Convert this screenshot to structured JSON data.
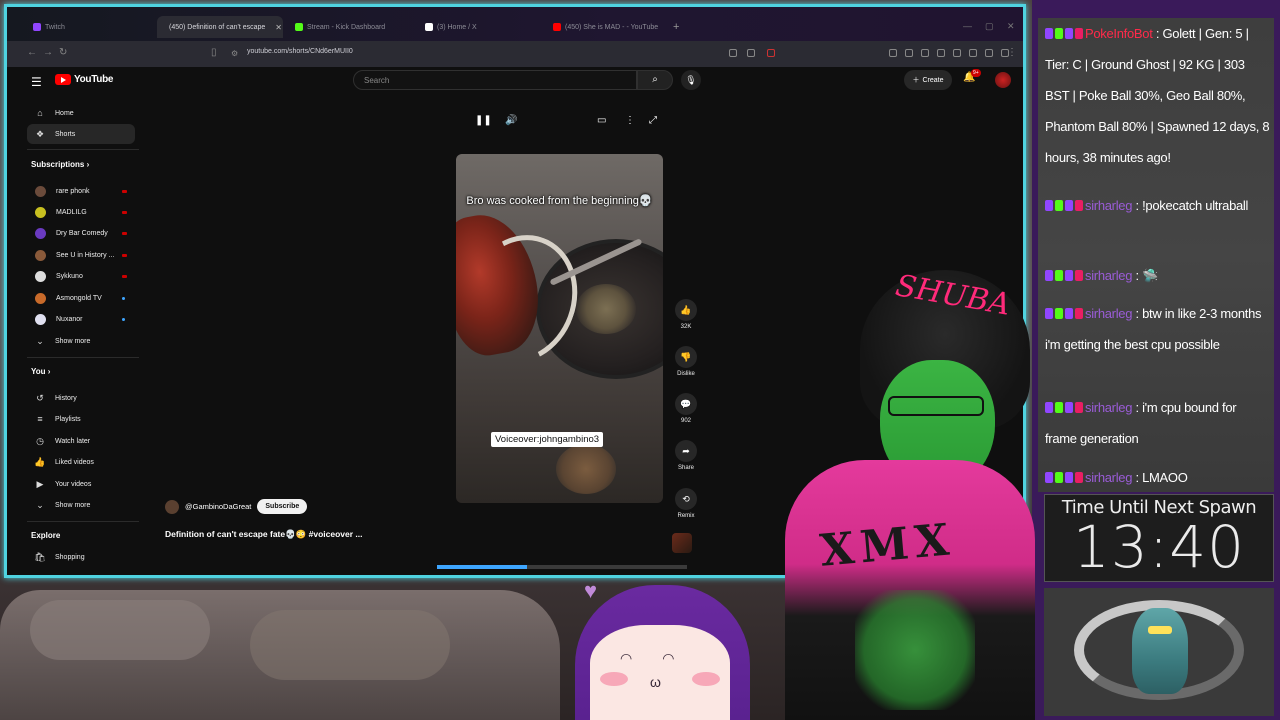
{
  "browser": {
    "tabs": [
      {
        "label": "Twitch",
        "active": false,
        "color": "#9146ff"
      },
      {
        "label": "(450) Definition of can't escape",
        "active": true,
        "color": "#ff0000"
      },
      {
        "label": "Stream - Kick Dashboard",
        "active": false,
        "color": "#53fc18"
      },
      {
        "label": "(3) Home / X",
        "active": false,
        "color": "#ffffff"
      },
      {
        "label": "(450) She is MAD - - YouTube",
        "active": false,
        "color": "#ff0000"
      }
    ],
    "url": "youtube.com/shorts/CNd6erMUII0"
  },
  "youtube": {
    "logo_text": "YouTube",
    "search_placeholder": "Search",
    "create_label": "Create",
    "notification_count": "9+",
    "sidebar": {
      "main": [
        {
          "label": "Home",
          "icon": "home-icon"
        },
        {
          "label": "Shorts",
          "icon": "shorts-icon",
          "active": true
        }
      ],
      "subscriptions_header": "Subscriptions",
      "subscriptions": [
        {
          "label": "rare phonk",
          "color": "#6b4b3b",
          "indicator": "live"
        },
        {
          "label": "MADLILG",
          "color": "#c8c020",
          "indicator": "live"
        },
        {
          "label": "Dry Bar Comedy",
          "color": "#6a3ac0",
          "indicator": "live"
        },
        {
          "label": "See U in History ...",
          "color": "#8a5a3a",
          "indicator": "live"
        },
        {
          "label": "Sykkuno",
          "color": "#dddddd",
          "indicator": "live"
        },
        {
          "label": "Asmongold TV",
          "color": "#c86a2a",
          "indicator": "new"
        },
        {
          "label": "Nuxanor",
          "color": "#e0e0f0",
          "indicator": "new"
        }
      ],
      "show_more": "Show more",
      "you_header": "You",
      "you_items": [
        {
          "label": "History",
          "icon": "history-icon"
        },
        {
          "label": "Playlists",
          "icon": "playlists-icon"
        },
        {
          "label": "Watch later",
          "icon": "watch-later-icon"
        },
        {
          "label": "Liked videos",
          "icon": "liked-icon"
        },
        {
          "label": "Your videos",
          "icon": "your-videos-icon"
        }
      ],
      "show_more_2": "Show more",
      "explore_header": "Explore",
      "explore_items": [
        {
          "label": "Shopping",
          "icon": "shopping-icon"
        }
      ]
    },
    "short": {
      "caption": "Bro was cooked from the beginning💀",
      "overlay": "Voiceover:johngambino3",
      "likes": "32K",
      "dislike_label": "Dislike",
      "comments": "902",
      "share_label": "Share",
      "remix_label": "Remix",
      "channel": "@GambinoDaGreat",
      "subscribe_label": "Subscribe",
      "title": "Definition of can't escape fate💀😳 #voiceover ...",
      "progress_percent": 36
    }
  },
  "chat": {
    "messages": [
      {
        "user": "PokeInfoBot",
        "user_class": "uname-red",
        "text": "Golett | Gen: 5 | Tier: C | Ground Ghost | 92 KG | 303 BST | Poke Ball 30%, Geo Ball 80%, Phantom Ball 80% | Spawned 12 days, 8 hours, 38 minutes ago!"
      },
      {
        "user": "sirharleg",
        "user_class": "uname-purple",
        "text": "!pokecatch ultraball"
      },
      {
        "user": "sirharleg",
        "user_class": "uname-purple",
        "text": "🛸"
      },
      {
        "user": "sirharleg",
        "user_class": "uname-purple",
        "text": "btw in like 2-3 months i'm getting the best cpu possible"
      },
      {
        "user": "sirharleg",
        "user_class": "uname-purple",
        "text": "i'm cpu bound for frame generation"
      },
      {
        "user": "sirharleg",
        "user_class": "uname-purple",
        "text": "LMAOO"
      }
    ]
  },
  "spawn": {
    "title": "Time Until Next Spawn",
    "time": "13:40"
  },
  "avatars": {
    "vtuber_hat_text": "SHUBA",
    "vtuber_hoodie_text": "XMX"
  }
}
